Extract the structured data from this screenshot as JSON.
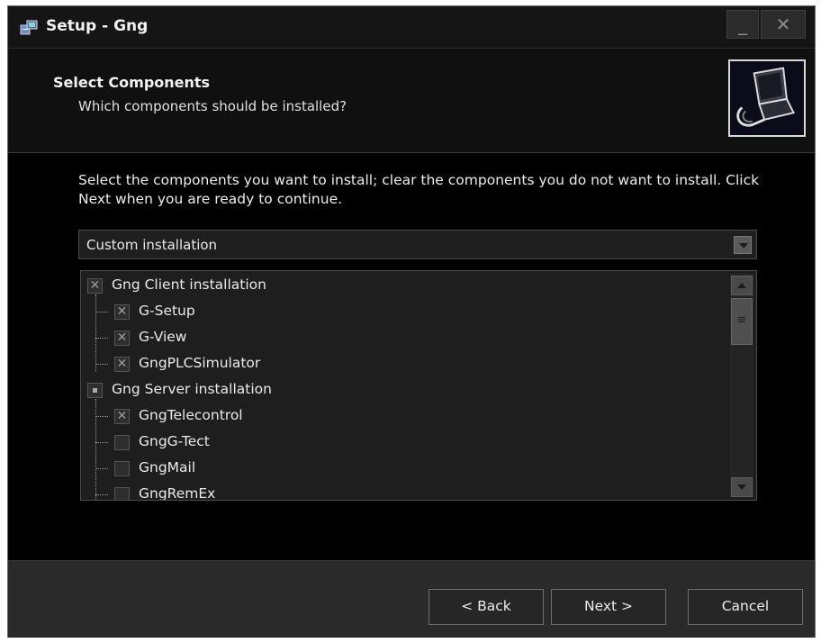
{
  "window": {
    "title": "Setup - Gng",
    "minimize_glyph": "_",
    "close_glyph": "✕"
  },
  "header": {
    "title": "Select Components",
    "subtitle": "Which components should be installed?",
    "image_icon": "computer-install-icon"
  },
  "content": {
    "description": "Select the components you want to install; clear the components you do not want to install. Click Next when you are ready to continue.",
    "install_type": {
      "selected": "Custom installation"
    },
    "components": [
      {
        "label": "Gng Client installation",
        "level": 0,
        "state": "checked"
      },
      {
        "label": "G-Setup",
        "level": 1,
        "state": "checked"
      },
      {
        "label": "G-View",
        "level": 1,
        "state": "checked"
      },
      {
        "label": "GngPLCSimulator",
        "level": 1,
        "state": "checked"
      },
      {
        "label": "Gng Server installation",
        "level": 0,
        "state": "partial"
      },
      {
        "label": "GngTelecontrol",
        "level": 1,
        "state": "checked"
      },
      {
        "label": "GngG-Tect",
        "level": 1,
        "state": "unchecked"
      },
      {
        "label": "GngMail",
        "level": 1,
        "state": "unchecked"
      },
      {
        "label": "GngRemEx",
        "level": 1,
        "state": "unchecked"
      }
    ],
    "scrollbar_thumb_glyph": "≡"
  },
  "footer": {
    "back_label": "< Back",
    "next_label": "Next >",
    "cancel_label": "Cancel"
  }
}
